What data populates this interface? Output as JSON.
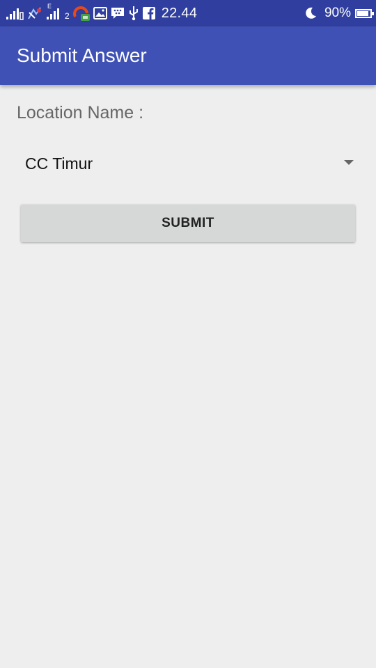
{
  "status_bar": {
    "time": "22.44",
    "battery_percent": "90%",
    "battery_level": 0.9,
    "sim2_label": "2",
    "network_type": "E",
    "icons": [
      "signal-icon",
      "signal-icon",
      "notification-icon",
      "signal-icon",
      "app-icon",
      "gallery-icon",
      "bbm-icon",
      "usb-icon",
      "facebook-icon",
      "moon-icon",
      "battery-icon"
    ]
  },
  "app_bar": {
    "title": "Submit Answer",
    "color": "#3f51b5",
    "status_color": "#303f9f"
  },
  "form": {
    "location_label": "Location Name :",
    "location_selected": "CC Timur",
    "submit_label": "SUBMIT"
  }
}
